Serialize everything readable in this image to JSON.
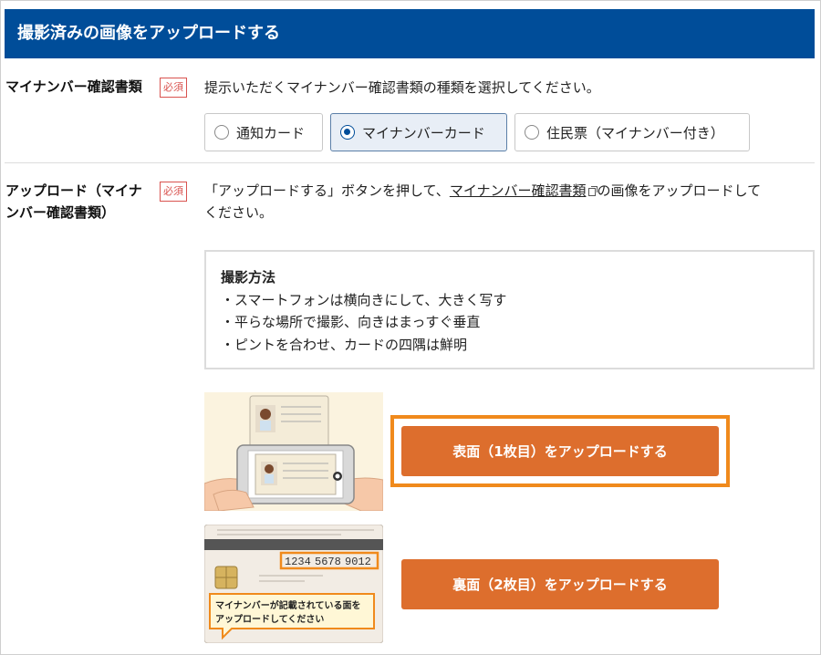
{
  "header": {
    "title": "撮影済みの画像をアップロードする"
  },
  "doc_type": {
    "label": "マイナンバー確認書類",
    "required": "必須",
    "description": "提示いただくマイナンバー確認書類の種類を選択してください。",
    "options": [
      {
        "label": "通知カード",
        "selected": false
      },
      {
        "label": "マイナンバーカード",
        "selected": true
      },
      {
        "label": "住民票（マイナンバー付き）",
        "selected": false
      }
    ]
  },
  "upload": {
    "label_line1": "アップロード（マイナ",
    "label_line2": "ンバー確認書類）",
    "required": "必須",
    "desc_before": "「アップロードする」ボタンを押して、",
    "desc_link": "マイナンバー確認書類",
    "desc_after": "の画像をアップロードして",
    "desc_line2": "ください。",
    "howto": {
      "title": "撮影方法",
      "items": [
        "・スマートフォンは横向きにして、大きく写す",
        "・平らな場所で撮影、向きはまっすぐ垂直",
        "・ピントを合わせ、カードの四隅は鮮明"
      ]
    },
    "front_button": "表面（1枚目）をアップロードする",
    "back_button": "裏面（2枚目）をアップロードする",
    "back_illustration": {
      "number_groups": [
        "1234",
        "5678",
        "9012"
      ],
      "callout_line1": "マイナンバーが記載されている面を",
      "callout_line2": "アップロードしてください"
    }
  },
  "colors": {
    "header": "#004d99",
    "button": "#dd6e2d",
    "focus": "#f08a1c",
    "required": "#d9534f"
  }
}
